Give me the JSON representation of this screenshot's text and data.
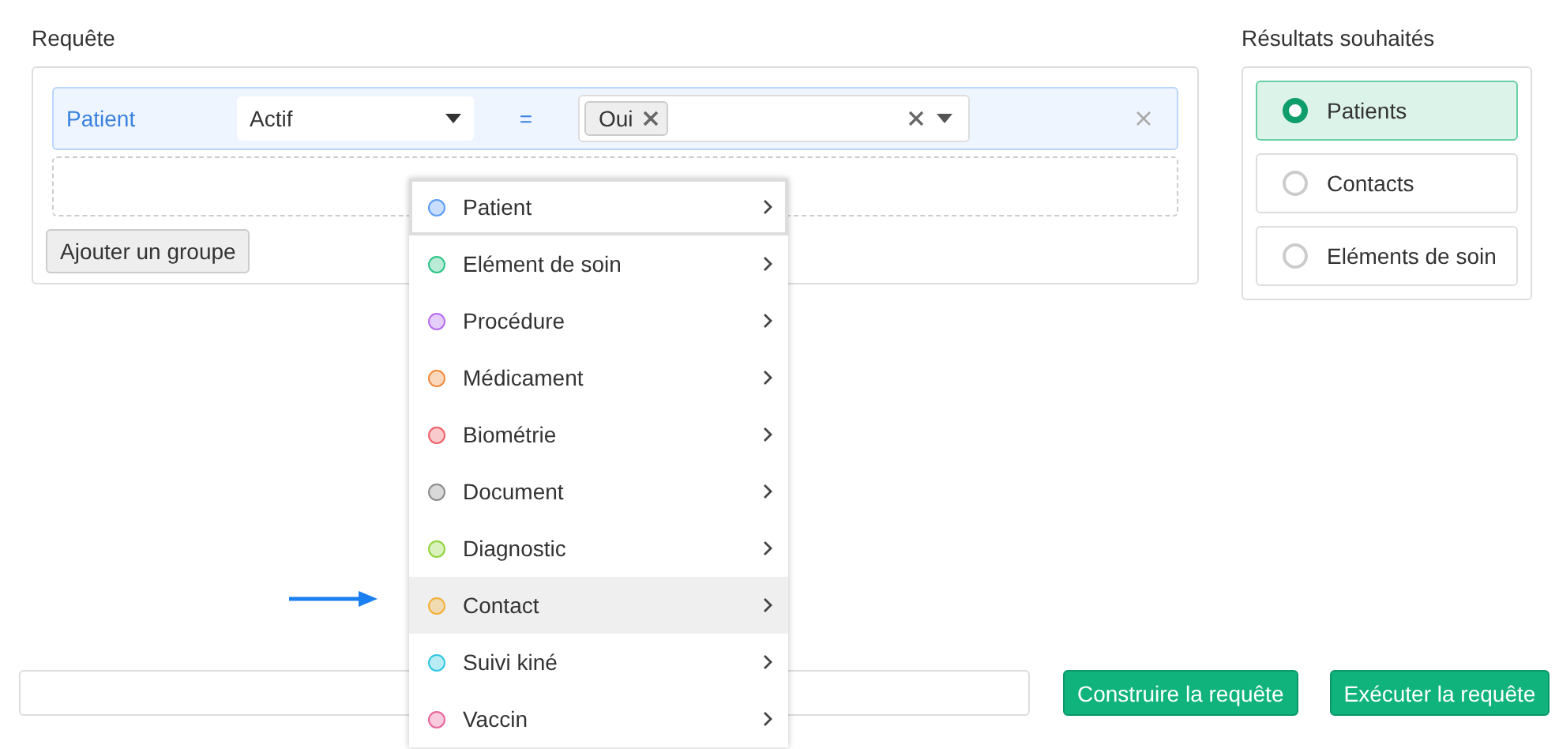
{
  "query": {
    "title": "Requête",
    "condition": {
      "entity": "Patient",
      "field": "Actif",
      "operator": "=",
      "tags": [
        "Oui"
      ]
    },
    "add_group_button": "Ajouter un groupe"
  },
  "results": {
    "title": "Résultats souhaités",
    "options": [
      {
        "label": "Patients",
        "selected": true
      },
      {
        "label": "Contacts",
        "selected": false
      },
      {
        "label": "Eléments de soin",
        "selected": false
      }
    ]
  },
  "menu": {
    "items": [
      {
        "label": "Patient",
        "color": "#5b9cf5",
        "focused": true,
        "hovered": false
      },
      {
        "label": "Elément de soin",
        "color": "#2ec486",
        "focused": false,
        "hovered": false
      },
      {
        "label": "Procédure",
        "color": "#b56cf0",
        "focused": false,
        "hovered": false
      },
      {
        "label": "Médicament",
        "color": "#f08a3c",
        "focused": false,
        "hovered": false
      },
      {
        "label": "Biométrie",
        "color": "#ec5f67",
        "focused": false,
        "hovered": false
      },
      {
        "label": "Document",
        "color": "#8c8c8c",
        "focused": false,
        "hovered": false
      },
      {
        "label": "Diagnostic",
        "color": "#8fd43a",
        "focused": false,
        "hovered": false
      },
      {
        "label": "Contact",
        "color": "#f2b035",
        "focused": false,
        "hovered": true
      },
      {
        "label": "Suivi kiné",
        "color": "#2ec6e0",
        "focused": false,
        "hovered": false
      },
      {
        "label": "Vaccin",
        "color": "#e8649a",
        "focused": false,
        "hovered": false
      }
    ]
  },
  "actions": [
    "Construire la requête",
    "Exécuter la requête"
  ]
}
